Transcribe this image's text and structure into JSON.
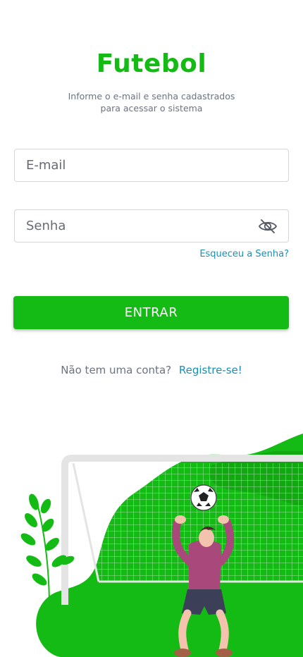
{
  "app": {
    "title": "Futebol",
    "subtitle_line1": "Informe o e-mail e senha cadastrados",
    "subtitle_line2": "para acessar o sistema"
  },
  "form": {
    "email_placeholder": "E-mail",
    "password_placeholder": "Senha",
    "password_toggle_icon": "eye-slash-icon",
    "forgot_password": "Esqueceu a Senha?",
    "submit_label": "ENTRAR"
  },
  "register": {
    "prompt": "Não tem uma conta?",
    "link": "Registre-se!"
  },
  "colors": {
    "brand": "#14bb14",
    "link": "#1a8fb5",
    "muted": "#6b7280"
  }
}
